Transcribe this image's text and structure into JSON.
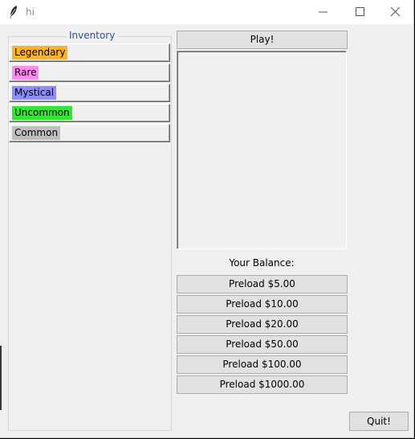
{
  "window": {
    "title": "hi"
  },
  "titlebar": {
    "icons": [
      "feather-icon",
      "minimize-icon",
      "maximize-icon",
      "close-icon"
    ]
  },
  "inventory": {
    "label": "Inventory",
    "items": [
      {
        "label": "Legendary",
        "color": "#ffb41e"
      },
      {
        "label": "Rare",
        "color": "#ff8cf0"
      },
      {
        "label": "Mystical",
        "color": "#8c8cff"
      },
      {
        "label": "Uncommon",
        "color": "#32e632"
      },
      {
        "label": "Common",
        "color": "#bebebe"
      }
    ]
  },
  "actions": {
    "play_label": "Play!",
    "quit_label": "Quit!"
  },
  "balance": {
    "label": "Your Balance:"
  },
  "preload_buttons": [
    "Preload $5.00",
    "Preload $10.00",
    "Preload $20.00",
    "Preload $50.00",
    "Preload $100.00",
    "Preload $1000.00"
  ]
}
